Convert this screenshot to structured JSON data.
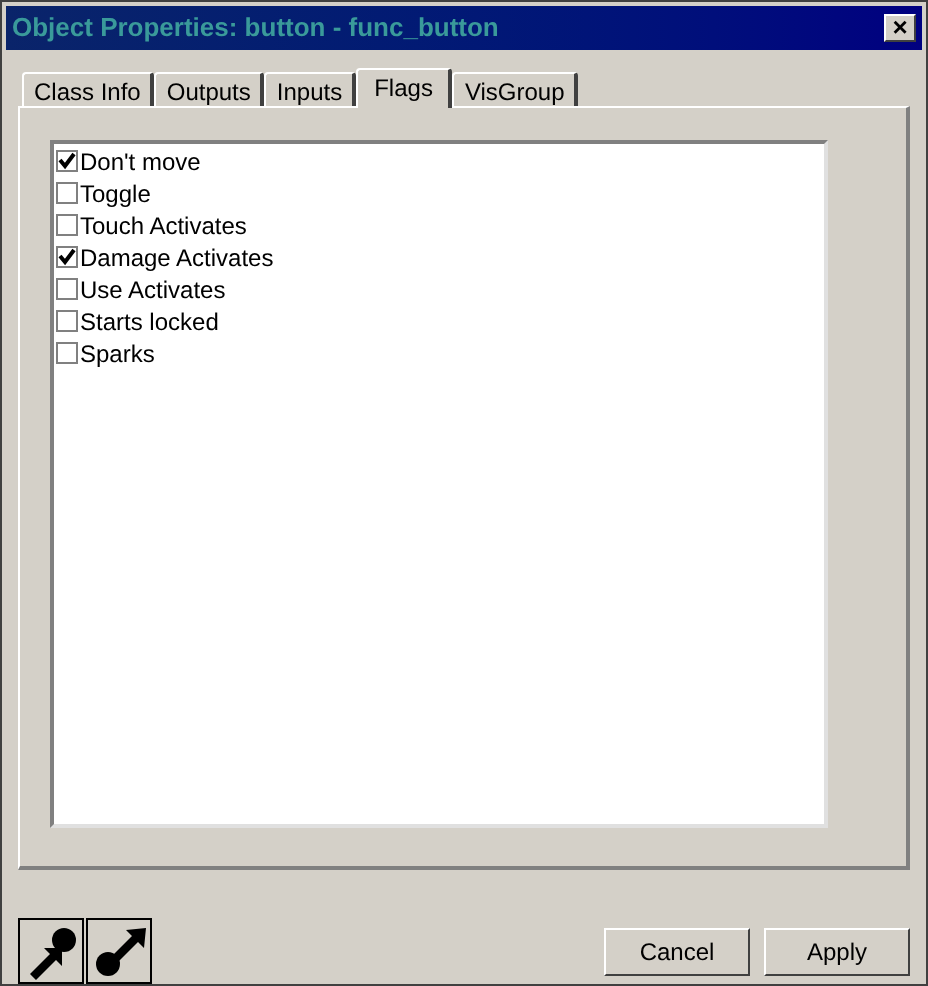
{
  "window": {
    "title": "Object Properties: button - func_button",
    "close": "×"
  },
  "tabs": [
    {
      "label": "Class Info",
      "selected": false
    },
    {
      "label": "Outputs",
      "selected": false
    },
    {
      "label": "Inputs",
      "selected": false
    },
    {
      "label": "Flags",
      "selected": true
    },
    {
      "label": "VisGroup",
      "selected": false
    }
  ],
  "flags": [
    {
      "label": "Don't move",
      "checked": true
    },
    {
      "label": "Toggle",
      "checked": false
    },
    {
      "label": "Touch Activates",
      "checked": false
    },
    {
      "label": "Damage Activates",
      "checked": true
    },
    {
      "label": "Use Activates",
      "checked": false
    },
    {
      "label": "Starts locked",
      "checked": false
    },
    {
      "label": "Sparks",
      "checked": false
    }
  ],
  "buttons": [
    "Cancel",
    "Apply"
  ]
}
